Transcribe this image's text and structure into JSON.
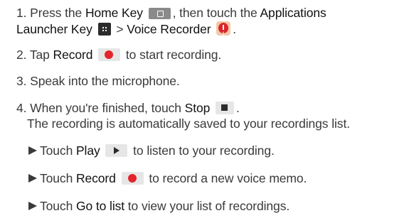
{
  "steps": {
    "s1": {
      "num": "1.",
      "t1": "Press the",
      "home_key": "Home Key",
      "t2": ", then touch the",
      "apps_word": "Applications",
      "apps_key": "Launcher Key",
      "t3": ">",
      "voice_recorder": "Voice Recorder",
      "t4": "."
    },
    "s2": {
      "num": "2.",
      "t1": "Tap",
      "record": "Record",
      "t2": "to start recording."
    },
    "s3": {
      "num": "3.",
      "t1": "Speak into the microphone."
    },
    "s4": {
      "num": "4.",
      "t1": "When you're finished, touch",
      "stop": "Stop",
      "t2": ".",
      "note": "The recording is automatically saved to your recordings list."
    }
  },
  "bullets": [
    {
      "t1": "Touch",
      "key": "Play",
      "t2": "to listen to your recording."
    },
    {
      "t1": "Touch",
      "key": "Record",
      "t2": "to record a new voice memo."
    },
    {
      "t1": "Touch",
      "key": "Go to list",
      "t2": "to view your list of recordings."
    }
  ],
  "icons": {
    "home": "home-key-icon",
    "apps": "apps-launcher-icon",
    "voice": "voice-recorder-app-icon",
    "record": "record-button-icon",
    "stop": "stop-button-icon",
    "play": "play-button-icon",
    "bullet": "triangle-bullet-icon"
  },
  "colors": {
    "record_red": "#e3242b",
    "text": "#3a3a3a",
    "key_text": "#111111"
  }
}
